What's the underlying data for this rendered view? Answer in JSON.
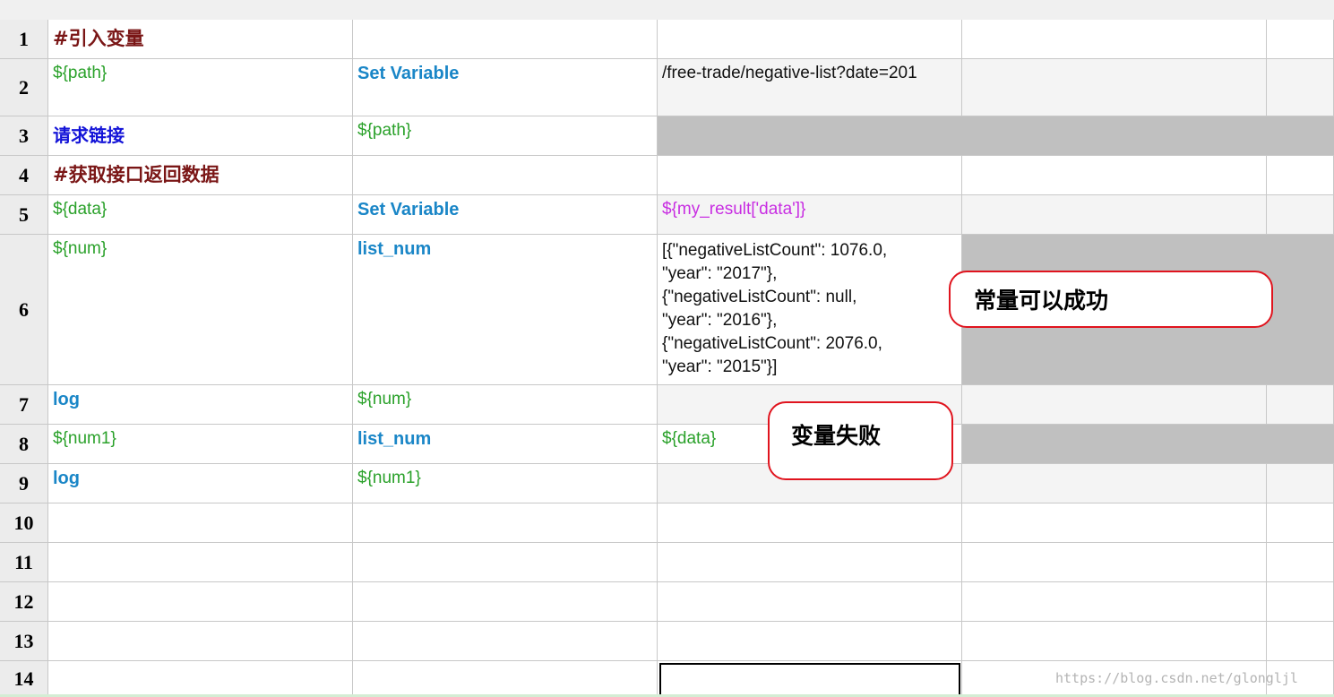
{
  "rows": [
    {
      "num": "1",
      "c1": "#引入变量",
      "c2": "",
      "c3": ""
    },
    {
      "num": "2",
      "c1": "${path}",
      "c2": "Set Variable",
      "c3": "/free-trade/negative-list?date=201"
    },
    {
      "num": "3",
      "c1": "请求链接",
      "c2": "${path}",
      "c3": ""
    },
    {
      "num": "4",
      "c1": "#获取接口返回数据",
      "c2": "",
      "c3": ""
    },
    {
      "num": "5",
      "c1": "${data}",
      "c2": "Set Variable",
      "c3": "${my_result['data']}"
    },
    {
      "num": "6",
      "c1": "${num}",
      "c2": "list_num",
      "c3": "[{\"negativeListCount\": 1076.0,\n\"year\": \"2017\"},\n{\"negativeListCount\": null,\n\"year\": \"2016\"},\n{\"negativeListCount\": 2076.0,\n\"year\": \"2015\"}]"
    },
    {
      "num": "7",
      "c1": "log",
      "c2": "${num}",
      "c3": ""
    },
    {
      "num": "8",
      "c1": "${num1}",
      "c2": "list_num",
      "c3": "${data}"
    },
    {
      "num": "9",
      "c1": "log",
      "c2": "${num1}",
      "c3": ""
    },
    {
      "num": "10",
      "c1": "",
      "c2": "",
      "c3": ""
    },
    {
      "num": "11",
      "c1": "",
      "c2": "",
      "c3": ""
    },
    {
      "num": "12",
      "c1": "",
      "c2": "",
      "c3": ""
    },
    {
      "num": "13",
      "c1": "",
      "c2": "",
      "c3": ""
    },
    {
      "num": "14",
      "c1": "",
      "c2": "",
      "c3": ""
    }
  ],
  "annotations": {
    "constant_success": "常量可以成功",
    "variable_fail": "变量失败"
  },
  "watermark": "https://blog.csdn.net/glongljl",
  "colors": {
    "comment": "#7a1616",
    "keyword": "#1a86c7",
    "keyword_chinese": "#1414d8",
    "variable": "#2aa12a",
    "purple_value": "#c82ee2",
    "annotation_border": "#e0141e",
    "grey_fill": "#c0c0c0"
  }
}
